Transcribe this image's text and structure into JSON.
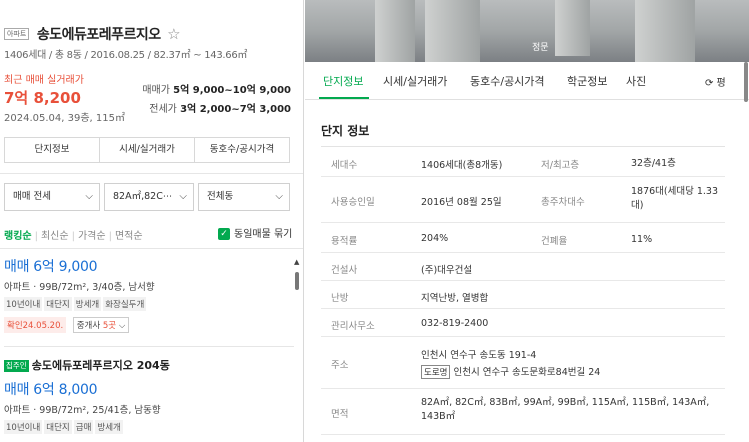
{
  "complex": {
    "badge": "아파트",
    "name": "송도에듀포레푸르지오",
    "star": "☆",
    "meta": "1406세대 / 총 8동 / 2016.08.25 / 82.37㎡ ~ 143.66㎡"
  },
  "recent": {
    "label": "최근 매매 실거래가",
    "price": "7억 8,200",
    "date": "2024.05.04, 39층, 115㎡",
    "sale_label": "매매가",
    "sale_range": "5억 9,000~10억 9,000",
    "jeonse_label": "전세가",
    "jeonse_range": "3억 2,000~7억 3,000"
  },
  "left_tabs": [
    "단지정보",
    "시세/실거래가",
    "동호수/공시가격"
  ],
  "filters": {
    "trade": "매매 전세",
    "area": "82A㎡,82C⋯",
    "dong": "전체동"
  },
  "sort": {
    "options": [
      "랭킹순",
      "최신순",
      "가격순",
      "면적순"
    ],
    "same_label": "동일매물 묶기"
  },
  "listings": [
    {
      "title": "",
      "price": "매매 6억 9,000",
      "info": "아파트 · 99B/72m², 3/40층, 남서향",
      "tags": [
        "10년이내",
        "대단지",
        "방세개",
        "화장실두개"
      ],
      "verify": "확인24.05.20.",
      "agent_prefix": "중개사 ",
      "agent_count": "5곳",
      "agent_chev": "⌵"
    },
    {
      "badge": "집주인",
      "title": "송도에듀포레푸르지오 204동",
      "price": "매매 6억 8,000",
      "info": "아파트 · 99B/72m², 25/41층, 남동향",
      "tags": [
        "10년이내",
        "대단지",
        "급매",
        "방세개"
      ]
    }
  ],
  "photo": {
    "label": "정문"
  },
  "right_tabs": [
    "단지정보",
    "시세/실거래가",
    "동호수/공시가격",
    "학군정보",
    "사진"
  ],
  "right_tab_btn": "⟳ 평",
  "section_title": "단지 정보",
  "info_rows": [
    {
      "k": "세대수",
      "v": "1406세대(총8개동)",
      "k2": "저/최고층",
      "v2": "32층/41층"
    },
    {
      "k": "사용승인일",
      "v": "2016년 08월 25일",
      "k2": "총주차대수",
      "v2": "1876대(세대당 1.33대)"
    },
    {
      "k": "용적률",
      "v": "204%",
      "k2": "건폐율",
      "v2": "11%"
    },
    {
      "k": "건설사",
      "v": "(주)대우건설"
    },
    {
      "k": "난방",
      "v": "지역난방, 열병합"
    },
    {
      "k": "관리사무소",
      "v": "032-819-2400"
    },
    {
      "k": "주소",
      "v": "인천시 연수구 송도동 191-4",
      "road_label": "도로명",
      "road": "인천시 연수구 송도문화로84번길 24"
    },
    {
      "k": "면적",
      "v": "82A㎡, 82C㎡, 83B㎡, 99A㎡, 99B㎡, 115A㎡, 115B㎡, 143A㎡, 143B㎡"
    }
  ],
  "colors": {
    "accent": "#03a94f",
    "price_red": "#e8503a",
    "price_blue": "#1a6fd4"
  }
}
